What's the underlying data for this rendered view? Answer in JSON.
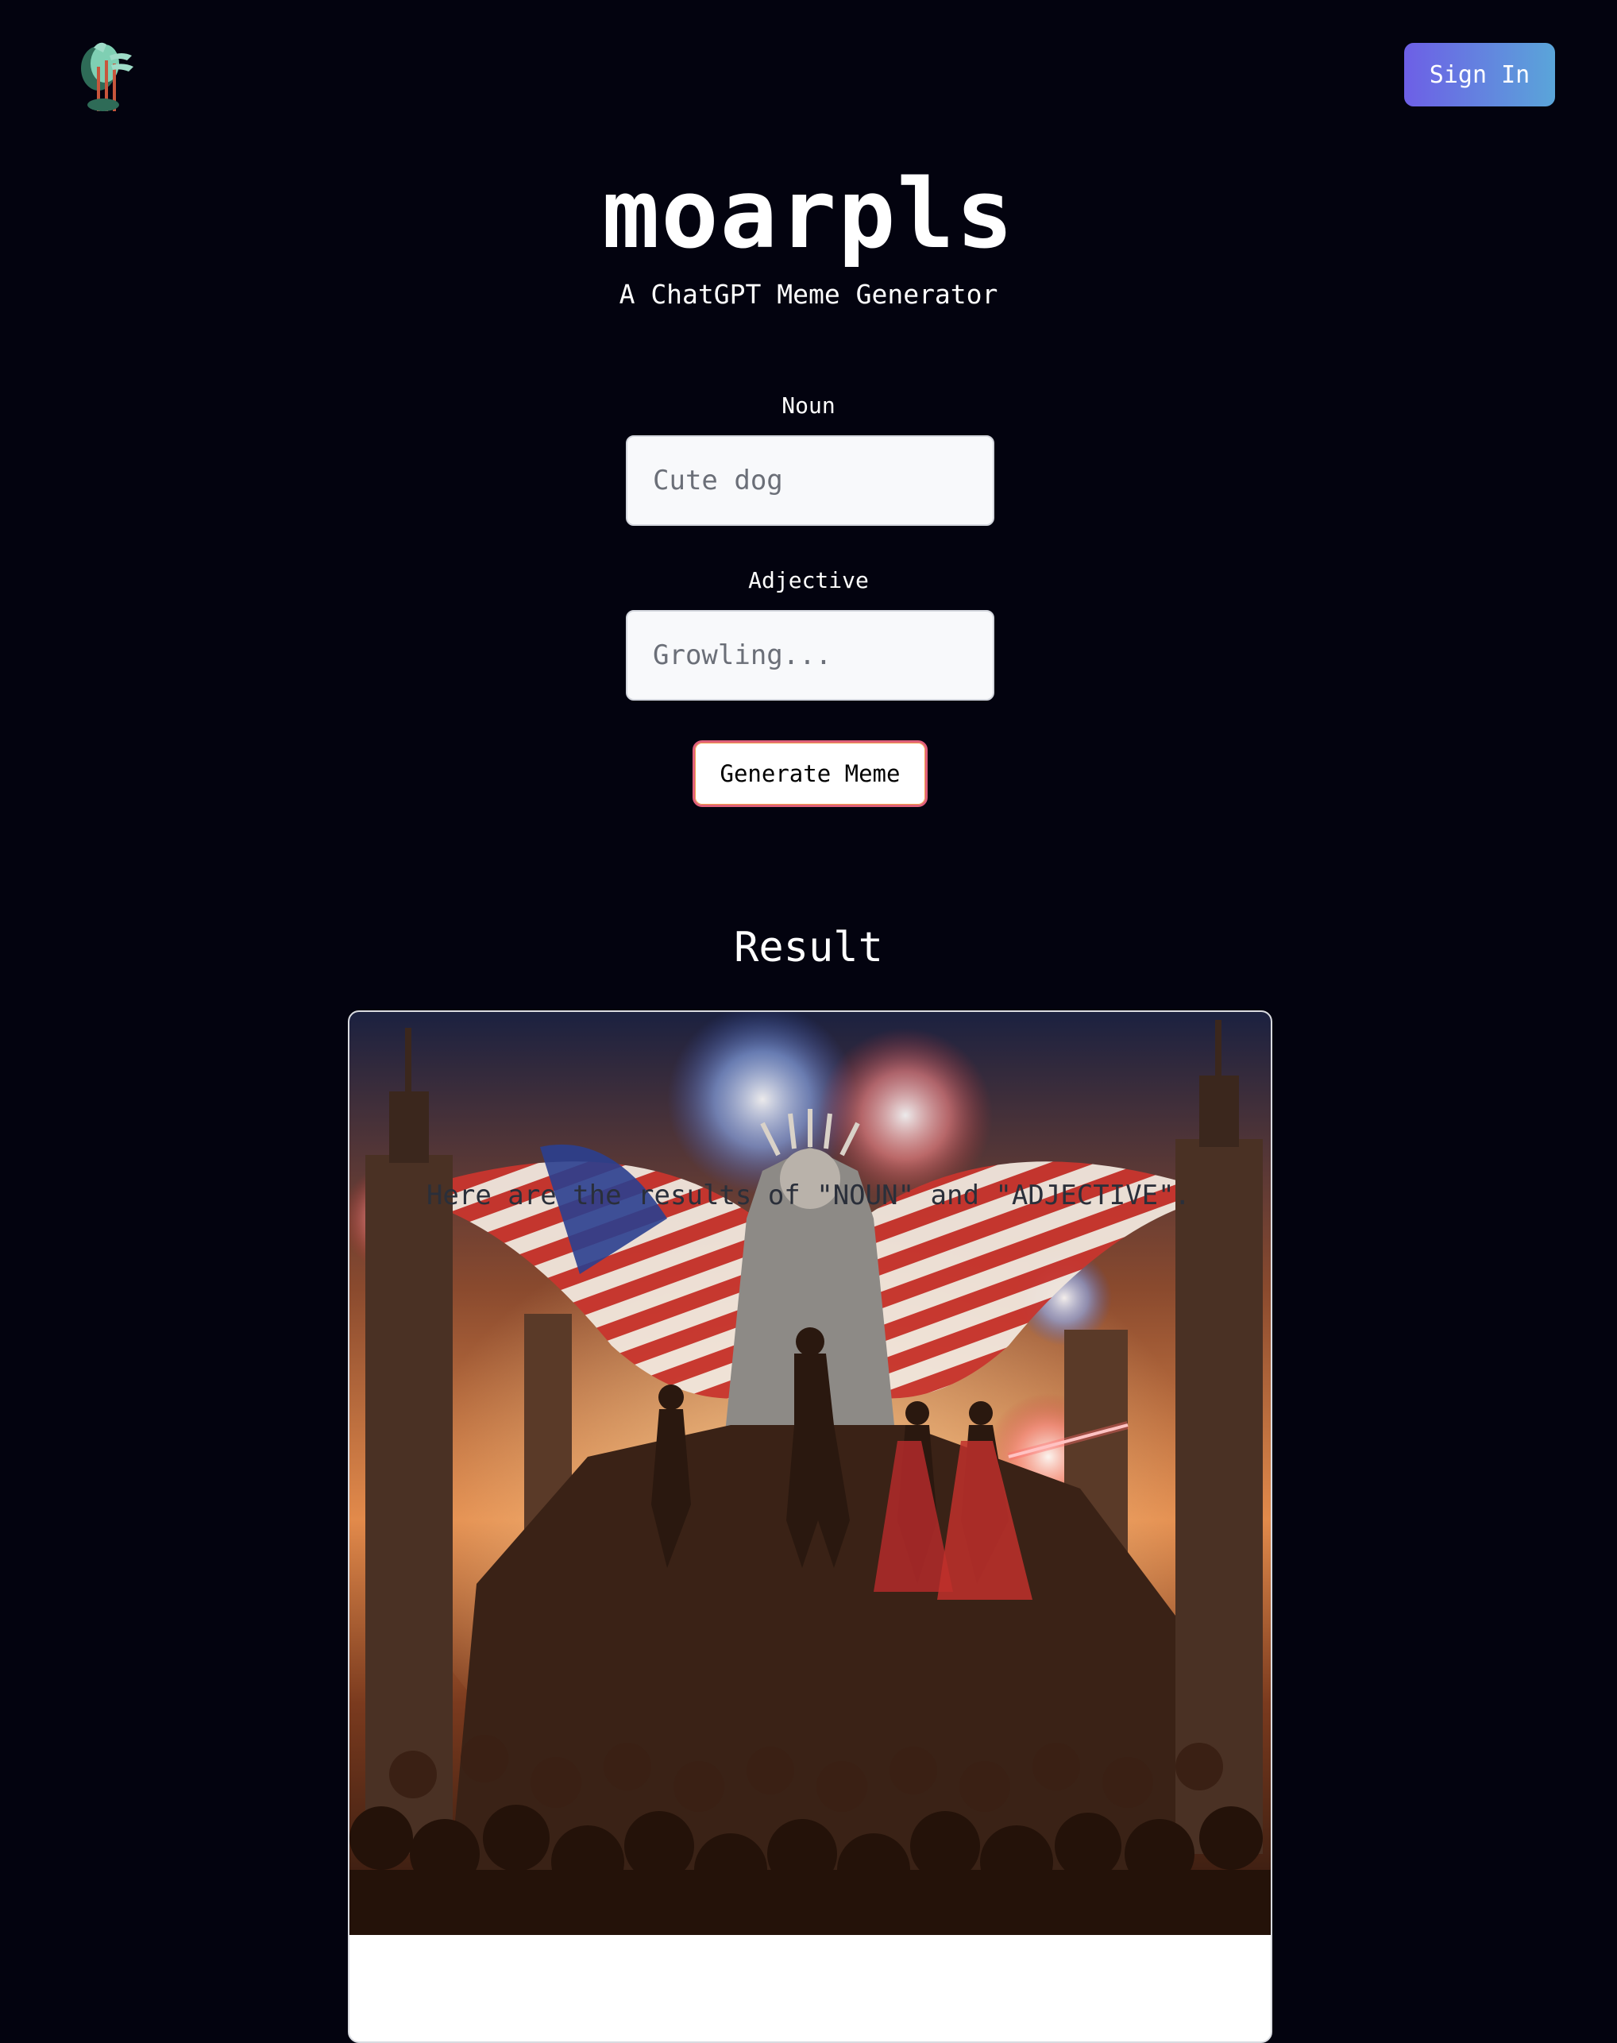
{
  "header": {
    "logo_icon": "tree-logo-icon",
    "sign_in_label": "Sign In"
  },
  "hero": {
    "title": "moarpls",
    "subtitle": "A ChatGPT Meme Generator"
  },
  "form": {
    "noun": {
      "label": "Noun",
      "value": "",
      "placeholder": "Cute dog"
    },
    "adjective": {
      "label": "Adjective",
      "value": "",
      "placeholder": "Growling..."
    },
    "generate_label": "Generate Meme"
  },
  "result": {
    "heading": "Result",
    "image_icon": "generated-meme-image",
    "caption": "Here are the results of \"NOUN\" and \"ADJECTIVE\"."
  },
  "colors": {
    "background": "#03030f",
    "sign_in_gradient_start": "#6d5fe6",
    "sign_in_gradient_end": "#5aa5d9",
    "generate_border": "#e0607a"
  }
}
